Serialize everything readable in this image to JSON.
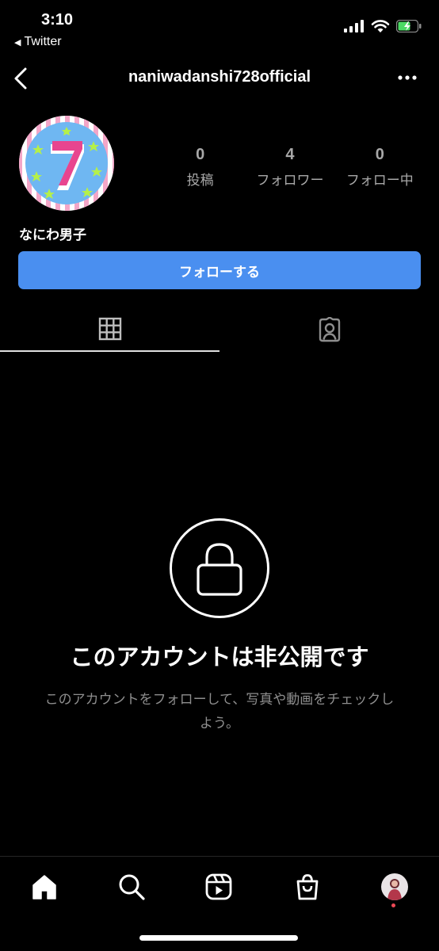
{
  "status_bar": {
    "time": "3:10",
    "back_app_label": "Twitter",
    "icons": [
      "cellular-signal-icon",
      "wifi-icon",
      "battery-charging-icon"
    ],
    "battery_color": "#4cd964"
  },
  "header": {
    "username": "naniwadanshi728official",
    "back_icon": "chevron-left-icon",
    "more_icon": "more-horizontal-icon"
  },
  "profile": {
    "display_name": "なにわ男子",
    "avatar_digit": "7",
    "stats": [
      {
        "value": "0",
        "label": "投稿"
      },
      {
        "value": "4",
        "label": "フォロワー"
      },
      {
        "value": "0",
        "label": "フォロー中"
      }
    ],
    "follow_button_label": "フォローする"
  },
  "tabs": [
    {
      "icon": "grid-icon",
      "active": true
    },
    {
      "icon": "tagged-person-icon",
      "active": false
    }
  ],
  "private_notice": {
    "icon": "lock-icon",
    "title": "このアカウントは非公開です",
    "message": "このアカウントをフォローして、写真や動画をチェックしよう。"
  },
  "bottom_nav": {
    "items": [
      "home-icon",
      "search-icon",
      "reels-icon",
      "shop-icon",
      "profile-avatar"
    ]
  },
  "colors": {
    "background": "#000000",
    "follow_button": "#4a8ff0",
    "muted_text": "#8e8e8e",
    "notification_dot": "#ed4956"
  }
}
